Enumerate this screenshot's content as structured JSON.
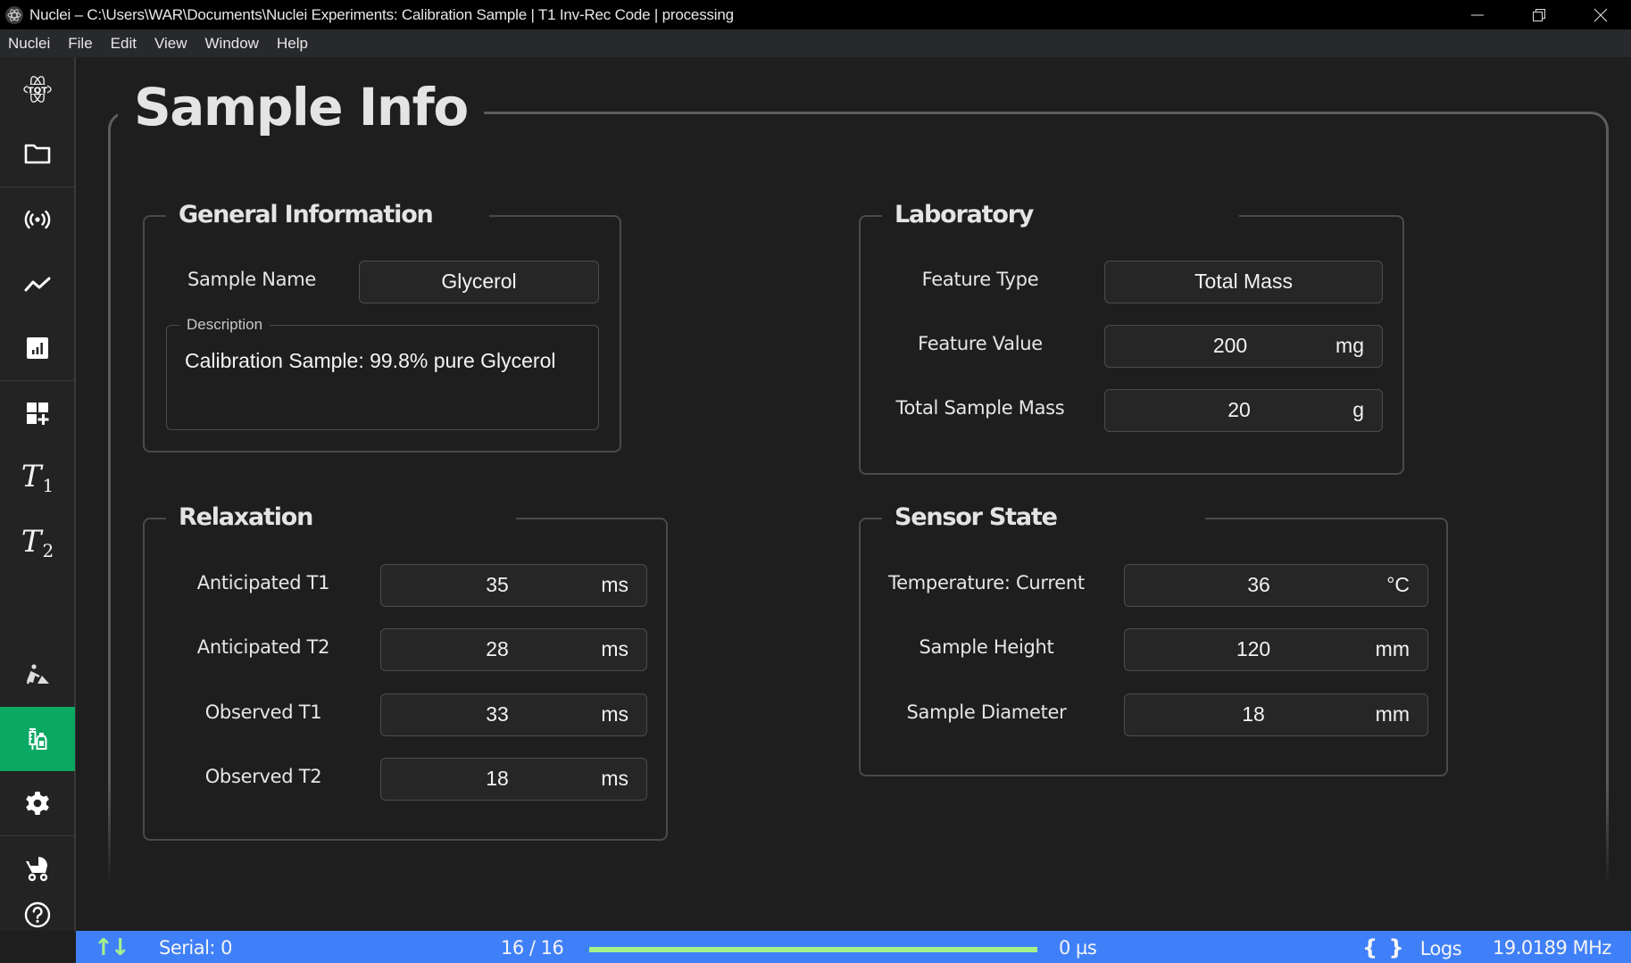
{
  "window": {
    "title": "Nuclei – C:\\Users\\WAR\\Documents\\Nuclei Experiments: Calibration Sample | T1 Inv-Rec Code | processing",
    "controls": [
      "minimize",
      "restore",
      "close"
    ]
  },
  "menu": {
    "items": [
      "Nuclei",
      "File",
      "Edit",
      "View",
      "Window",
      "Help"
    ]
  },
  "sidebar": {
    "items": [
      {
        "icon": "tqt-atom-logo-icon"
      },
      {
        "icon": "folder-icon"
      },
      {
        "icon": "broadcast-signal-icon"
      },
      {
        "icon": "line-chart-icon"
      },
      {
        "icon": "bar-chart-icon"
      },
      {
        "icon": "add-widget-icon"
      },
      {
        "icon": "t1-icon",
        "label": "T",
        "sub": "1"
      },
      {
        "icon": "t2-icon",
        "label": "T",
        "sub": "2"
      },
      {
        "icon": "construction-worker-icon"
      },
      {
        "icon": "sample-vials-icon",
        "active": true
      },
      {
        "icon": "settings-gear-icon"
      },
      {
        "icon": "baby-stroller-icon"
      },
      {
        "icon": "help-circle-icon"
      }
    ],
    "active_color": "#0aa862"
  },
  "page": {
    "title": "Sample Info"
  },
  "general": {
    "title": "General Information",
    "sample_name_label": "Sample Name",
    "sample_name_value": "Glycerol",
    "description_legend": "Description",
    "description_value": "Calibration Sample: 99.8% pure Glycerol"
  },
  "laboratory": {
    "title": "Laboratory",
    "fields": [
      {
        "label": "Feature Type",
        "value": "Total Mass",
        "unit": ""
      },
      {
        "label": "Feature Value",
        "value": "200",
        "unit": "mg"
      },
      {
        "label": "Total Sample Mass",
        "value": "20",
        "unit": "g"
      }
    ]
  },
  "relaxation": {
    "title": "Relaxation",
    "fields": [
      {
        "label": "Anticipated T1",
        "value": "35",
        "unit": "ms"
      },
      {
        "label": "Anticipated T2",
        "value": "28",
        "unit": "ms"
      },
      {
        "label": "Observed T1",
        "value": "33",
        "unit": "ms"
      },
      {
        "label": "Observed T2",
        "value": "18",
        "unit": "ms"
      }
    ]
  },
  "sensor": {
    "title": "Sensor State",
    "fields": [
      {
        "label": "Temperature: Current",
        "value": "36",
        "unit": "°C"
      },
      {
        "label": "Sample Height",
        "value": "120",
        "unit": "mm"
      },
      {
        "label": "Sample Diameter",
        "value": "18",
        "unit": "mm"
      }
    ]
  },
  "statusbar": {
    "arrows": "↑↓",
    "serial": "Serial: 0",
    "progress_text": "16 / 16",
    "progress_fraction": 1.0,
    "time": "0 µs",
    "logs_icon": "{ }",
    "logs_label": "Logs",
    "frequency": "19.0189 MHz",
    "color": "#3f80f9",
    "accent": "#a6f28a"
  }
}
